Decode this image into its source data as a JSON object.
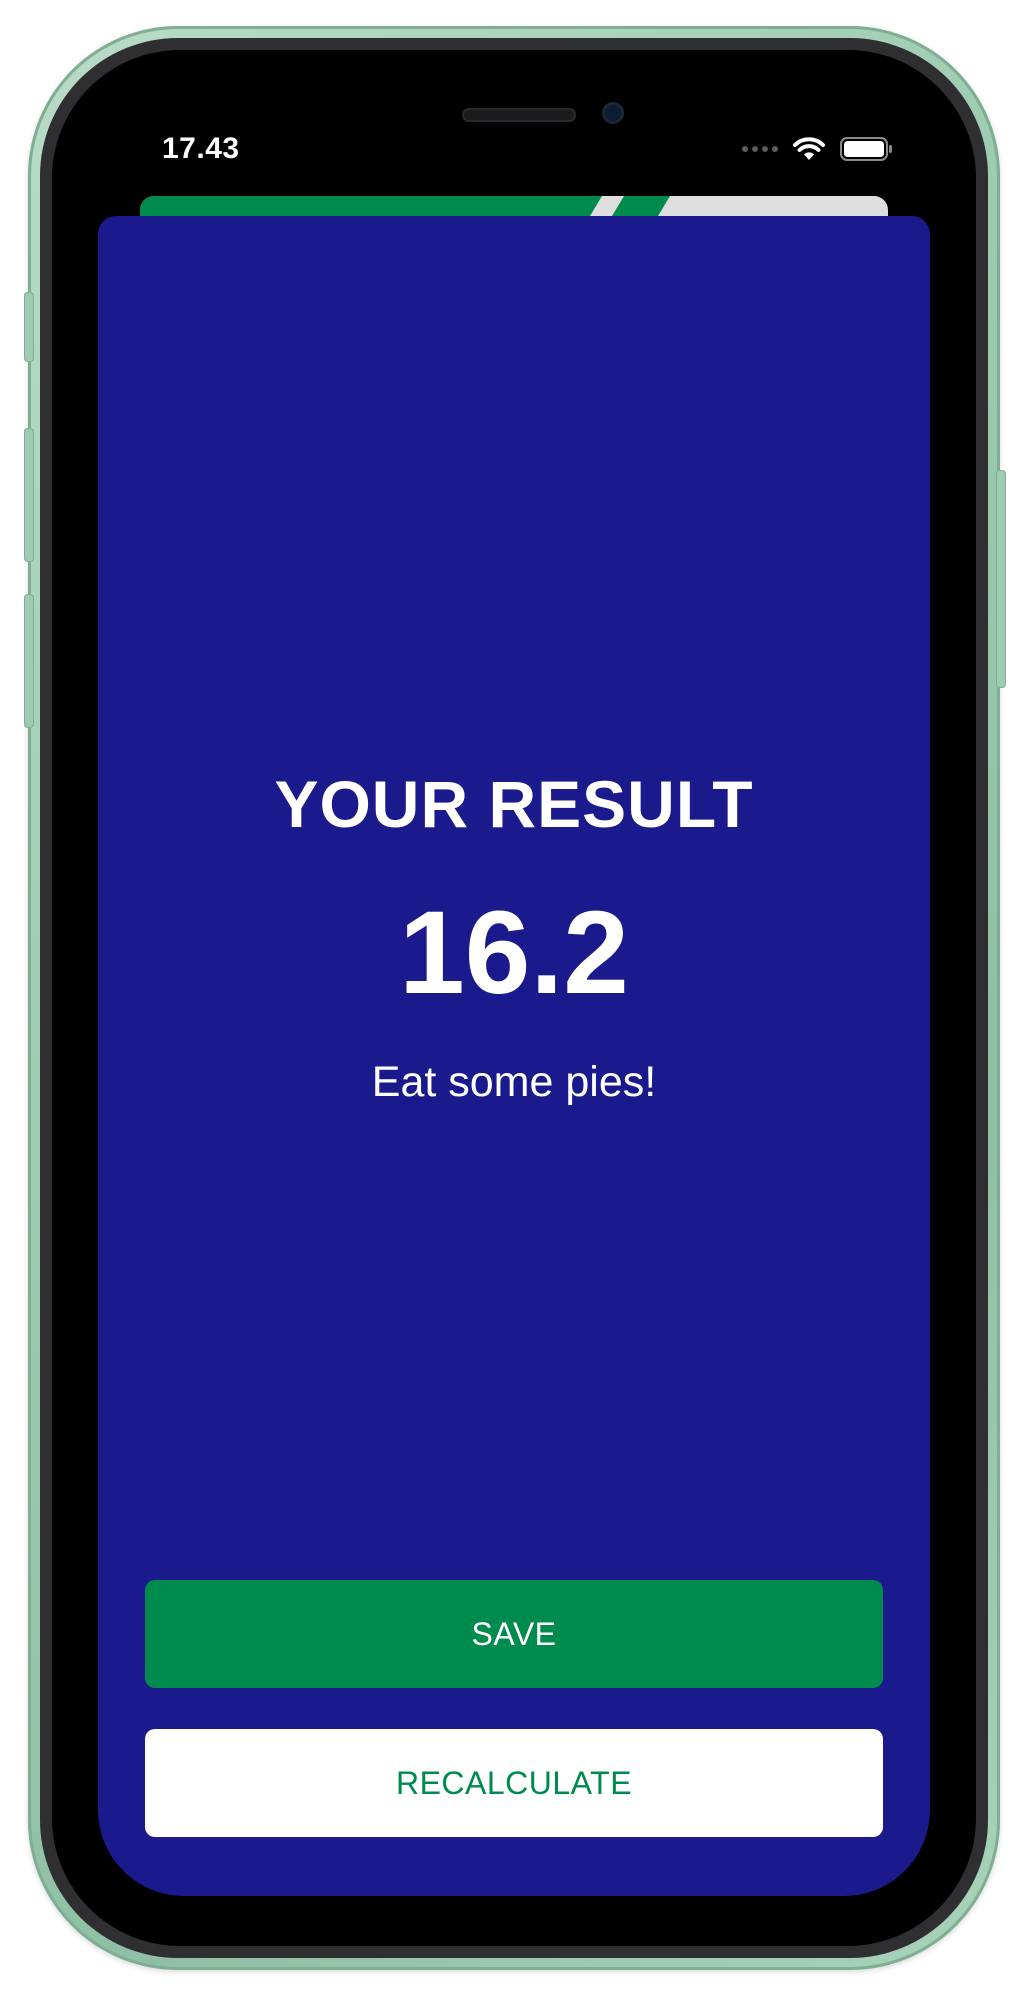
{
  "status_bar": {
    "time": "17.43",
    "icons": [
      "cellular-signal-icon",
      "wifi-icon",
      "battery-icon"
    ]
  },
  "result": {
    "title": "YOUR RESULT",
    "value": "16.2",
    "advice": "Eat some pies!"
  },
  "actions": {
    "save_label": "SAVE",
    "recalculate_label": "RECALCULATE"
  },
  "colors": {
    "background": "#1a1a8c",
    "primary": "#008b4e",
    "text": "#ffffff",
    "secondary_button_background": "#ffffff"
  }
}
